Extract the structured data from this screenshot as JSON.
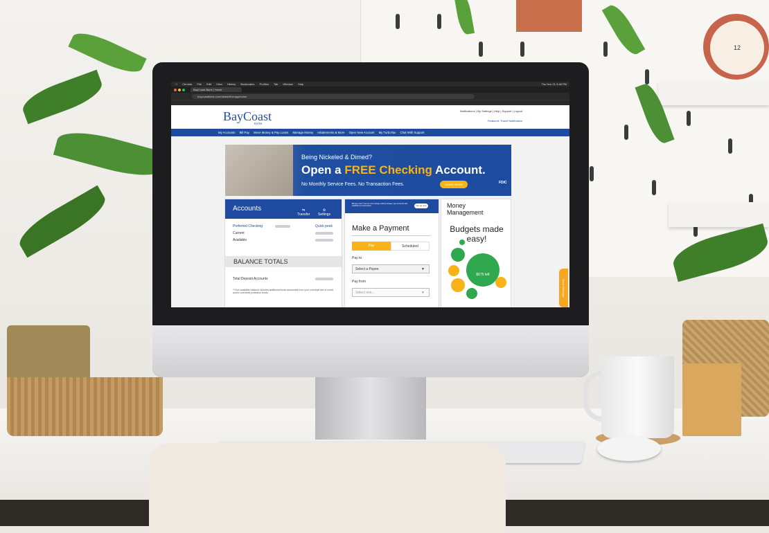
{
  "browser": {
    "menu": [
      "Chrome",
      "File",
      "Edit",
      "View",
      "History",
      "Bookmarks",
      "Profiles",
      "Tab",
      "Window",
      "Help"
    ],
    "clock": "Thu Nov 21 3:48 PM",
    "tab_title": "BayCoast Bank | Home",
    "url": "baycoastbank.com/dbank/live/app/home",
    "bookmarks_label": "Main"
  },
  "site": {
    "logo": "BayCoast",
    "logo_sub": "BANK",
    "top_links": "Notifications | My Settings | Help | Support | Logout",
    "featured": "Featured: Travel Notification",
    "nav": [
      "My Accounts",
      "Bill Pay",
      "Move Money & Pay Loans",
      "Manage Money",
      "eStatements & More",
      "Open New Account",
      "My TurboTax",
      "Chat With Support"
    ]
  },
  "banner": {
    "line1": "Being Nickeled & Dimed?",
    "line2_pre": "Open a ",
    "line2_hl": "FREE Checking",
    "line2_post": " Account.",
    "line3": "No Monthly Service Fees. No Transaction Fees.",
    "cta": "LEARN MORE",
    "fdic": "FDIC"
  },
  "accounts": {
    "title": "Accounts",
    "transfer": "Transfer",
    "settings": "Settings",
    "account_name": "Preferred Checking",
    "quick_peek": "Quick peek",
    "current": "Current",
    "available": "Available",
    "balance_totals": "BALANCE TOTALS",
    "total_deposit": "Total Deposit Accounts",
    "footnote": "**Your available balance includes additional funds accessible from your overdraft line of credit and/or overdraft protection funds."
  },
  "payment": {
    "notice": "Bill pay more? You can now manage activity between your accounts with available text instructions.",
    "notice_btn": "Set up now",
    "title": "Make a Payment",
    "tab_pay": "Pay",
    "tab_scheduled": "Scheduled",
    "pay_to": "Pay to",
    "payee_placeholder": "Select a Payee",
    "pay_from": "Pay from",
    "from_placeholder": "Select one..."
  },
  "money": {
    "title": "Money Management",
    "headline": "Budgets made easy!",
    "bubble_main": "$675 left"
  },
  "send_message": "Send Message",
  "colors": {
    "brand_blue": "#1e4ba0",
    "accent_orange": "#f8b319",
    "budget_green": "#2fa84f"
  }
}
